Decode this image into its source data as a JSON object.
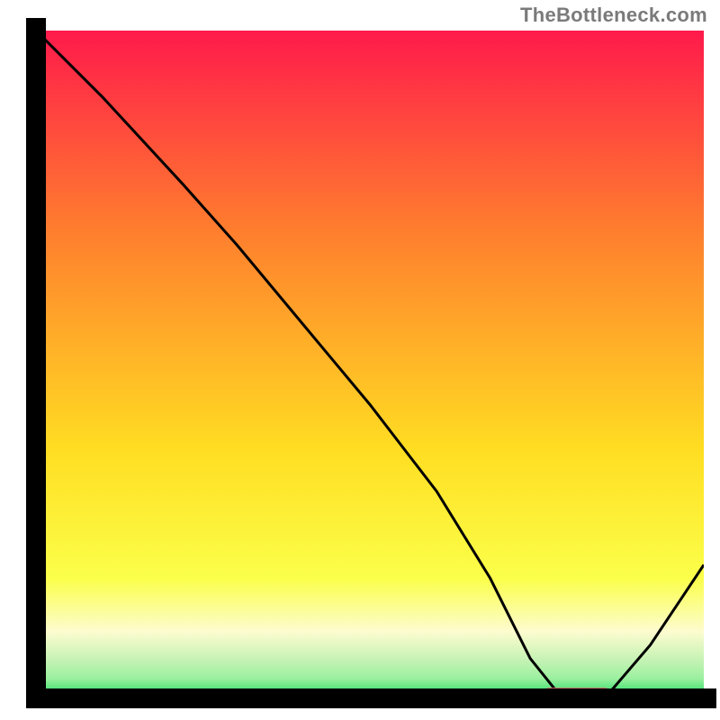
{
  "attribution": "TheBottleneck.com",
  "colors": {
    "frame": "#000000",
    "curve": "#000000",
    "marker_fill": "#d86b6b",
    "grad_top": "#ff1a4b",
    "grad_mid1": "#ff7e2e",
    "grad_mid2": "#ffde22",
    "grad_pale": "#fdfccf",
    "grad_green_light": "#9cf0a0",
    "grad_green": "#17d85a"
  },
  "chart_data": {
    "type": "line",
    "title": "",
    "xlabel": "",
    "ylabel": "",
    "xlim": [
      0,
      100
    ],
    "ylim": [
      0,
      100
    ],
    "series": [
      {
        "name": "bottleneck-curve",
        "x": [
          0,
          10,
          22,
          30,
          40,
          50,
          60,
          68,
          74,
          78,
          82,
          86,
          92,
          100
        ],
        "y": [
          100,
          90,
          77,
          68,
          56,
          44,
          31,
          18,
          6,
          1,
          0,
          1,
          8,
          20
        ]
      }
    ],
    "marker": {
      "name": "optimal-zone",
      "x_start": 76,
      "x_end": 86,
      "y": 0.8
    },
    "gradient_stops_pct": [
      0,
      30,
      63,
      82,
      90,
      94,
      97,
      100
    ]
  }
}
